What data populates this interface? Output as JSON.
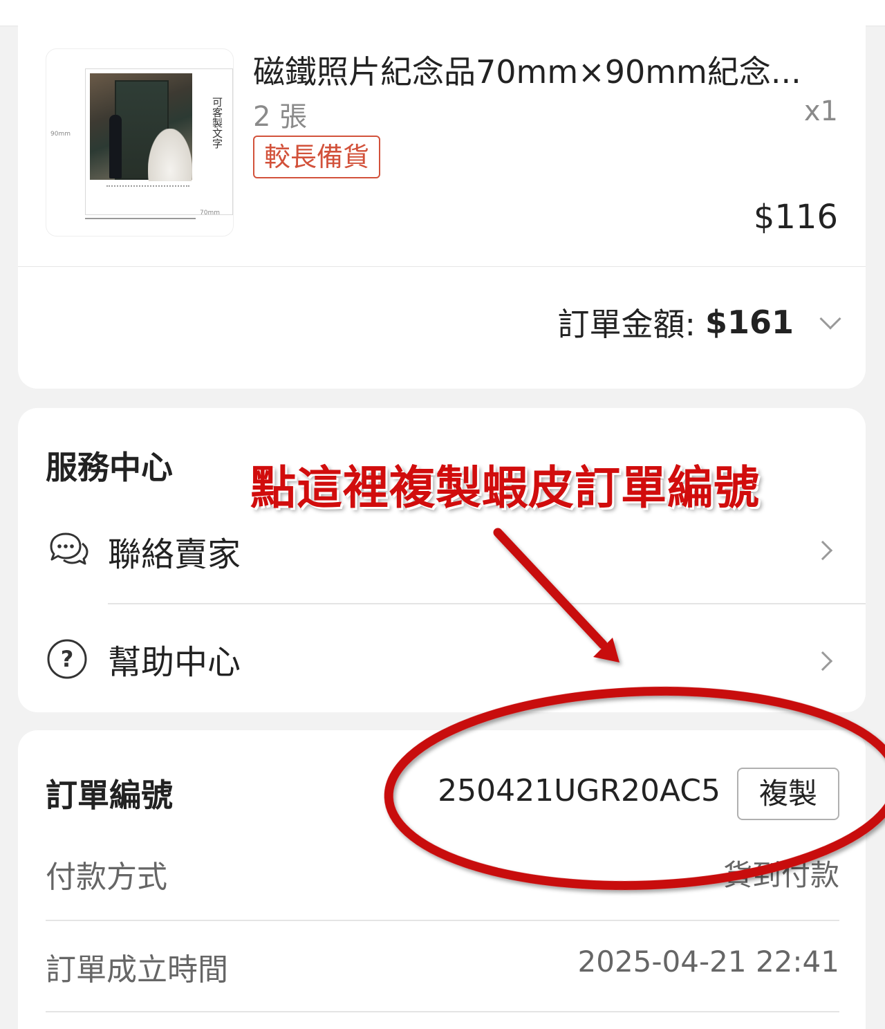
{
  "product": {
    "title": "磁鐵照片紀念品70mm×90mm紀念...",
    "variant": "2 張",
    "quantity": "x1",
    "badge": "較長備貨",
    "price": "$116",
    "thumbnail": {
      "vertical_text": "可客製文字",
      "dim_height": "90mm",
      "dim_width": "70mm"
    }
  },
  "order_total": {
    "label": "訂單金額:",
    "amount": "$161"
  },
  "service_center": {
    "title": "服務中心",
    "items": [
      {
        "label": "聯絡賣家",
        "icon": "chat-bubble-icon"
      },
      {
        "label": "幫助中心",
        "icon": "question-circle-icon"
      }
    ]
  },
  "order_info": {
    "title": "訂單編號",
    "order_number": "250421UGR20AC5",
    "copy_label": "複製",
    "rows": [
      {
        "key": "付款方式",
        "value": "貨到付款"
      },
      {
        "key": "訂單成立時間",
        "value": "2025-04-21 22:41"
      }
    ]
  },
  "annotation": {
    "text": "點這裡複製蝦皮訂單編號",
    "color": "#d10d0d"
  },
  "colors": {
    "badge": "#d2513a",
    "background": "#f2f2f2",
    "card": "#ffffff"
  }
}
